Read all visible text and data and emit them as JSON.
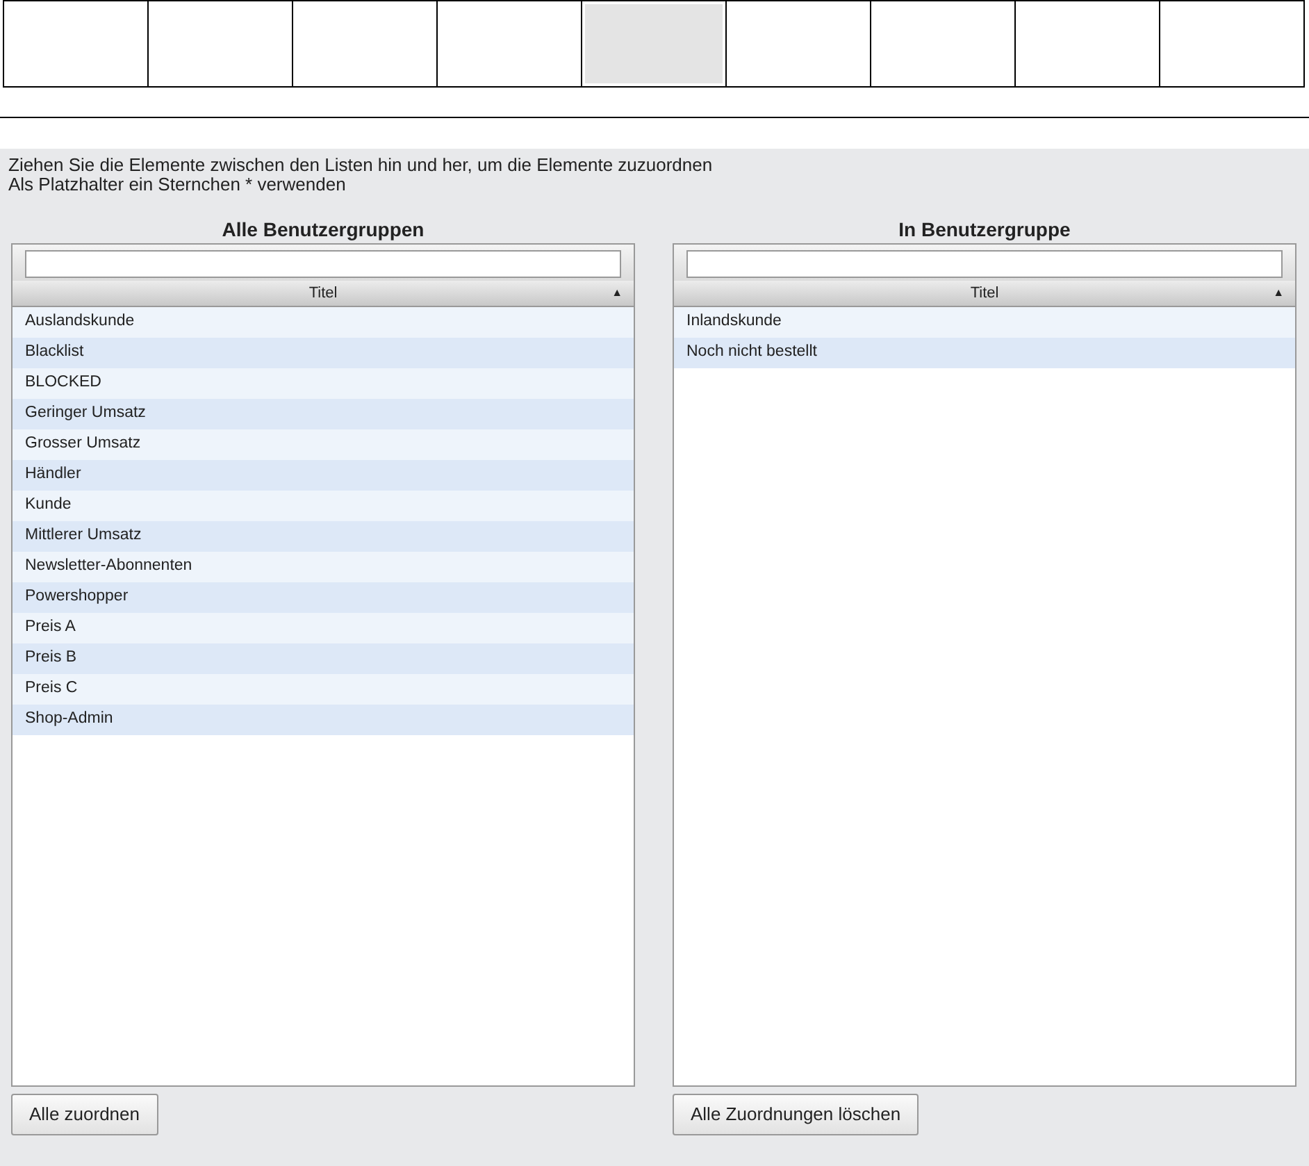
{
  "top_cells": [
    {
      "selected": false
    },
    {
      "selected": false
    },
    {
      "selected": false
    },
    {
      "selected": false
    },
    {
      "selected": true
    },
    {
      "selected": false
    },
    {
      "selected": false
    },
    {
      "selected": false
    },
    {
      "selected": false
    }
  ],
  "instructions": [
    "Ziehen Sie die Elemente zwischen den Listen hin und her, um die Elemente zuzuordnen",
    "Als Platzhalter ein Sternchen * verwenden"
  ],
  "lists": [
    {
      "title": "Alle Benutzergruppen",
      "column": "Titel",
      "sort_icon": "▲",
      "items": [
        "Auslandskunde",
        "Blacklist",
        "BLOCKED",
        "Geringer Umsatz",
        "Grosser Umsatz",
        "Händler",
        "Kunde",
        "Mittlerer Umsatz",
        "Newsletter-Abonnenten",
        "Powershopper",
        "Preis A",
        "Preis B",
        "Preis C",
        "Shop-Admin"
      ],
      "button": "Alle zuordnen"
    },
    {
      "title": "In Benutzergruppe",
      "column": "Titel",
      "sort_icon": "▲",
      "items": [
        "Inlandskunde",
        "Noch nicht bestellt"
      ],
      "button": "Alle Zuordnungen löschen"
    }
  ]
}
